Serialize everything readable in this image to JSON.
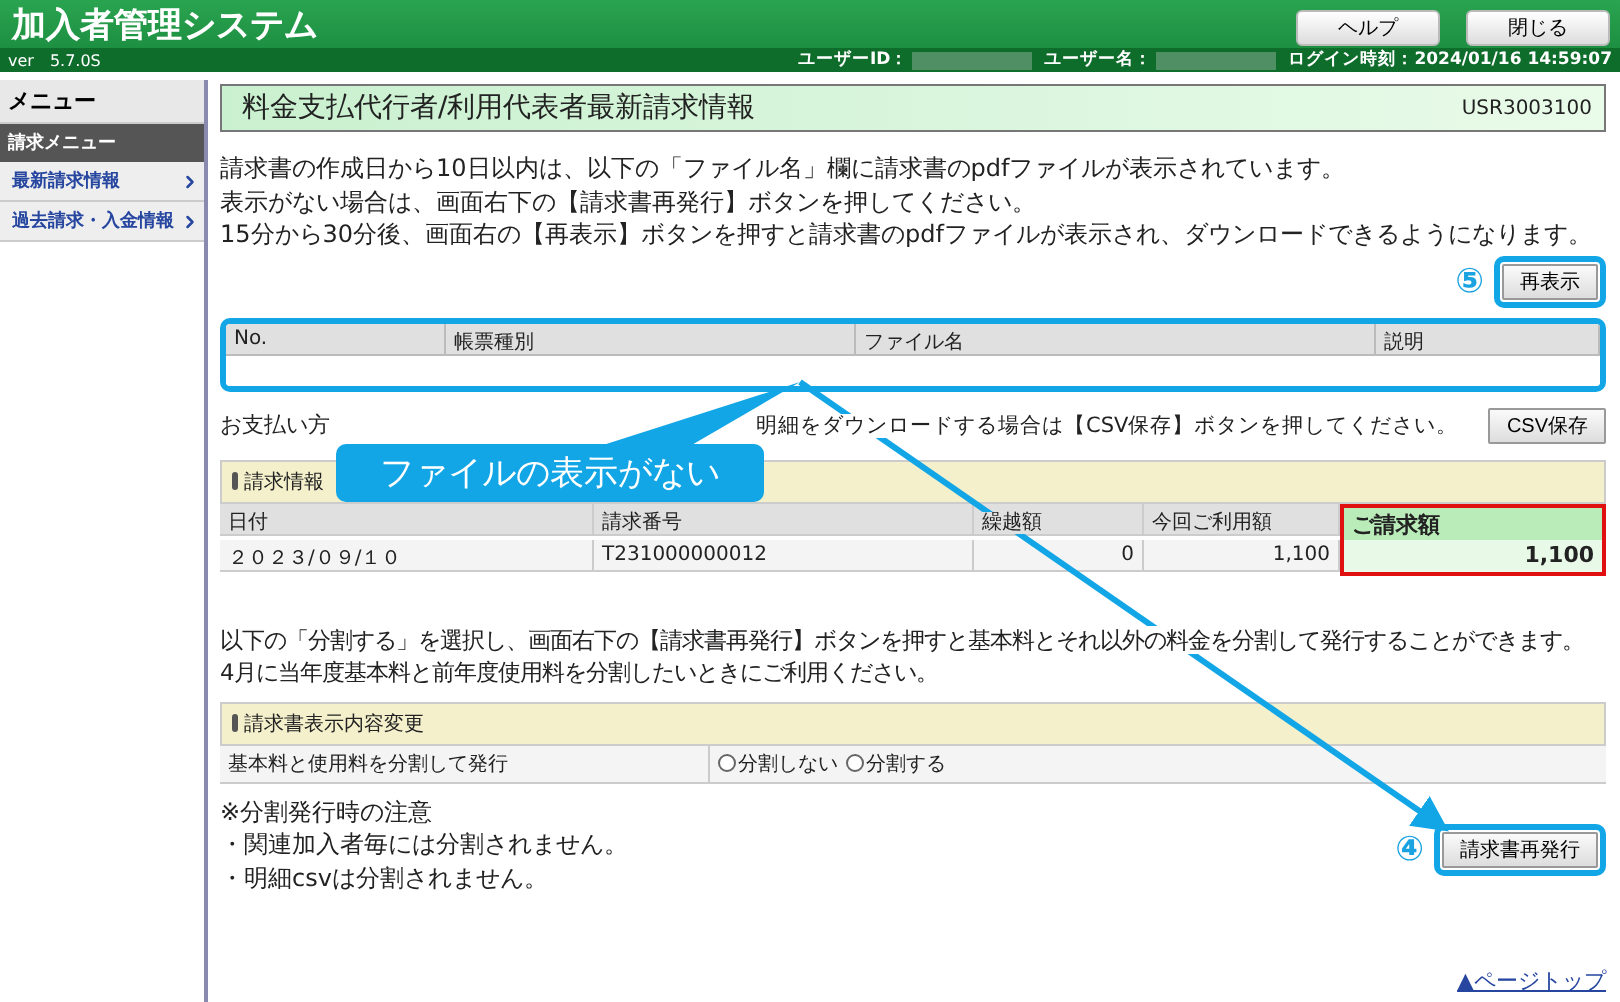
{
  "header": {
    "title": "加入者管理システム",
    "version": "ver　5.7.0S",
    "buttons": [
      "ヘルプ",
      "閉じる"
    ],
    "user_fields": [
      {
        "label": "ユーザーID：",
        "masked": true
      },
      {
        "label": "ユーザー名：",
        "masked": true
      },
      {
        "label": "ログイン時刻：2024/01/16 14:59:07",
        "masked": false
      }
    ]
  },
  "sidebar": {
    "title": "メニュー",
    "section": "請求メニュー",
    "items": [
      {
        "label": "最新請求情報"
      },
      {
        "label": "過去請求・入金情報"
      }
    ]
  },
  "page": {
    "title": "料金支払代行者/利用代表者最新請求情報",
    "screen_id": "USR3003100",
    "intro": [
      "請求書の作成日から10日以内は、以下の「ファイル名」欄に請求書のpdfファイルが表示されています。",
      "表示がない場合は、画面右下の【請求書再発行】ボタンを押してください。",
      "15分から30分後、画面右の【再表示】ボタンを押すと請求書のpdfファイルが表示され、ダウンロードできるようになります。"
    ],
    "refresh_button": {
      "label": "再表示",
      "marker": "⑤",
      "highlighted": true
    },
    "file_table": {
      "highlighted": true,
      "columns": [
        "No.",
        "帳票種別",
        "ファイル名",
        "説明"
      ]
    },
    "payment_note": "お支払い方",
    "csv_note": "明細をダウンロードする場合は【CSV保存】ボタンを押してください。",
    "csv_button": "CSV保存",
    "billing": {
      "heading": "請求情報",
      "columns": [
        "日付",
        "請求番号",
        "繰越額",
        "今回ご利用額",
        "ご請求額"
      ],
      "row": [
        "２０２３/０９/１０",
        "T231000000012",
        "0",
        "1,100",
        "1,100"
      ]
    },
    "split_intro": [
      "以下の「分割する」を選択し、画面右下の【請求書再発行】ボタンを押すと基本料とそれ以外の料金を分割して発行することができます。",
      "4月に当年度基本料と前年度使用料を分割したいときにご利用ください。"
    ],
    "display_change": {
      "heading": "請求書表示内容変更",
      "label": "基本料と使用料を分割して発行",
      "options": [
        {
          "label": "分割しない",
          "selected": false
        },
        {
          "label": "分割する",
          "selected": false
        }
      ]
    },
    "notes": [
      "※分割発行時の注意",
      "・関連加入者毎には分割されません。",
      "・明細csvは分割されません。"
    ],
    "reissue_button": {
      "label": "請求書再発行",
      "marker": "④",
      "highlighted": true
    },
    "page_top": "▲ページトップ"
  },
  "callout": "ファイルの表示がない"
}
